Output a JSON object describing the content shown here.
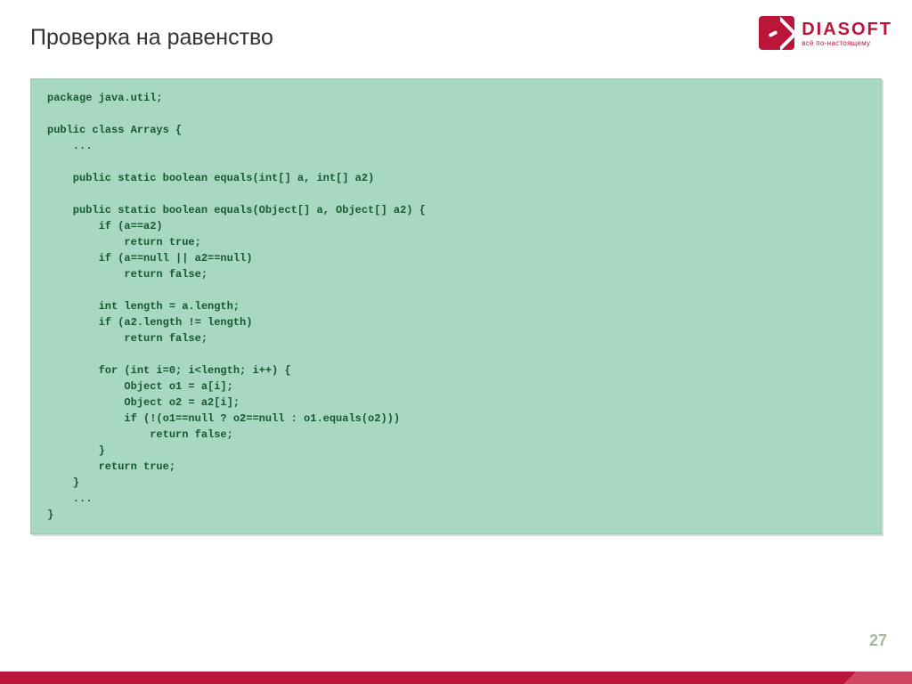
{
  "title": "Проверка на равенство",
  "logo": {
    "brand": "DIASOFT",
    "tagline": "всё   по-настоящему"
  },
  "code": "package java.util;\n\npublic class Arrays {\n    ...\n\n    public static boolean equals(int[] a, int[] a2)\n\n    public static boolean equals(Object[] a, Object[] a2) {\n        if (a==a2)\n            return true;\n        if (a==null || a2==null)\n            return false;\n\n        int length = a.length;\n        if (a2.length != length)\n            return false;\n\n        for (int i=0; i<length; i++) {\n            Object o1 = a[i];\n            Object o2 = a2[i];\n            if (!(o1==null ? o2==null : o1.equals(o2)))\n                return false;\n        }\n        return true;\n    }\n    ...\n}",
  "pageNumber": "27"
}
